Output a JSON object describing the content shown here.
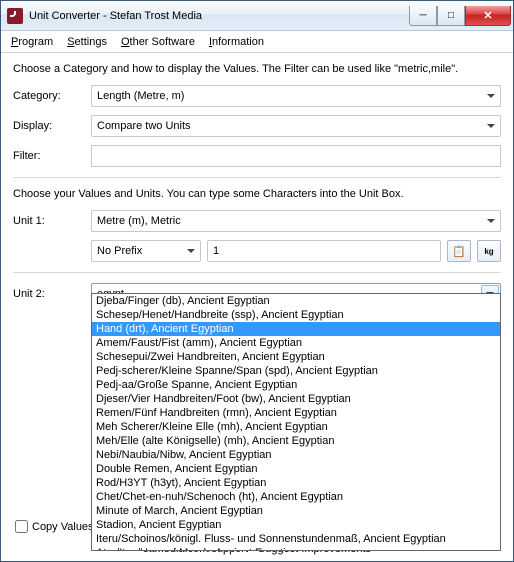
{
  "title": "Unit Converter - Stefan Trost Media",
  "menu": {
    "program": "Program",
    "settings": "Settings",
    "other": "Other Software",
    "info": "Information"
  },
  "section1": {
    "instruction": "Choose a Category and how to display the Values. The Filter can be used like \"metric,mile\".",
    "category_label": "Category:",
    "category_value": "Length (Metre, m)",
    "display_label": "Display:",
    "display_value": "Compare two Units",
    "filter_label": "Filter:",
    "filter_value": ""
  },
  "section2": {
    "instruction": "Choose your Values and Units. You can type some Characters into the Unit Box.",
    "unit1_label": "Unit 1:",
    "unit1_value": "Metre (m), Metric",
    "prefix_value": "No Prefix",
    "amount_value": "1",
    "unit2_label": "Unit 2:",
    "unit2_value": "egypt"
  },
  "dropdown_items": [
    "Djeba/Finger (db), Ancient Egyptian",
    "Schesep/Henet/Handbreite (ssp), Ancient Egyptian",
    "Hand (drt), Ancient Egyptian",
    "Amem/Faust/Fist (amm), Ancient Egyptian",
    "Schesepui/Zwei Handbreiten, Ancient Egyptian",
    "Pedj-scherer/Kleine Spanne/Span (spd), Ancient Egyptian",
    "Pedj-aa/Große Spanne, Ancient Egyptian",
    "Djeser/Vier Handbreiten/Foot (bw), Ancient Egyptian",
    "Remen/Fünf Handbreiten (rmn), Ancient Egyptian",
    "Meh Scherer/Kleine Elle (mh), Ancient Egyptian",
    "Meh/Elle (alte Königselle) (mh), Ancient Egyptian",
    "Nebi/Naubia/Nibw, Ancient Egyptian",
    "Double Remen, Ancient Egyptian",
    "Rod/H3YT (h3yt), Ancient Egyptian",
    "Chet/Chet-en-nuh/Schenoch (ht), Ancient Egyptian",
    "Minute of March, Ancient Egyptian",
    "Stadion, Ancient Egyptian",
    "Iteru/Schoinos/königl. Fluss- und Sonnenstundenmaß, Ancient Egyptian",
    "Atur/Itrw/Hour of March, Ancient Egyptian"
  ],
  "dropdown_selected_index": 2,
  "copy_label": "Copy Values",
  "footer": "sttmedia.com/support - Suggest Improvements"
}
